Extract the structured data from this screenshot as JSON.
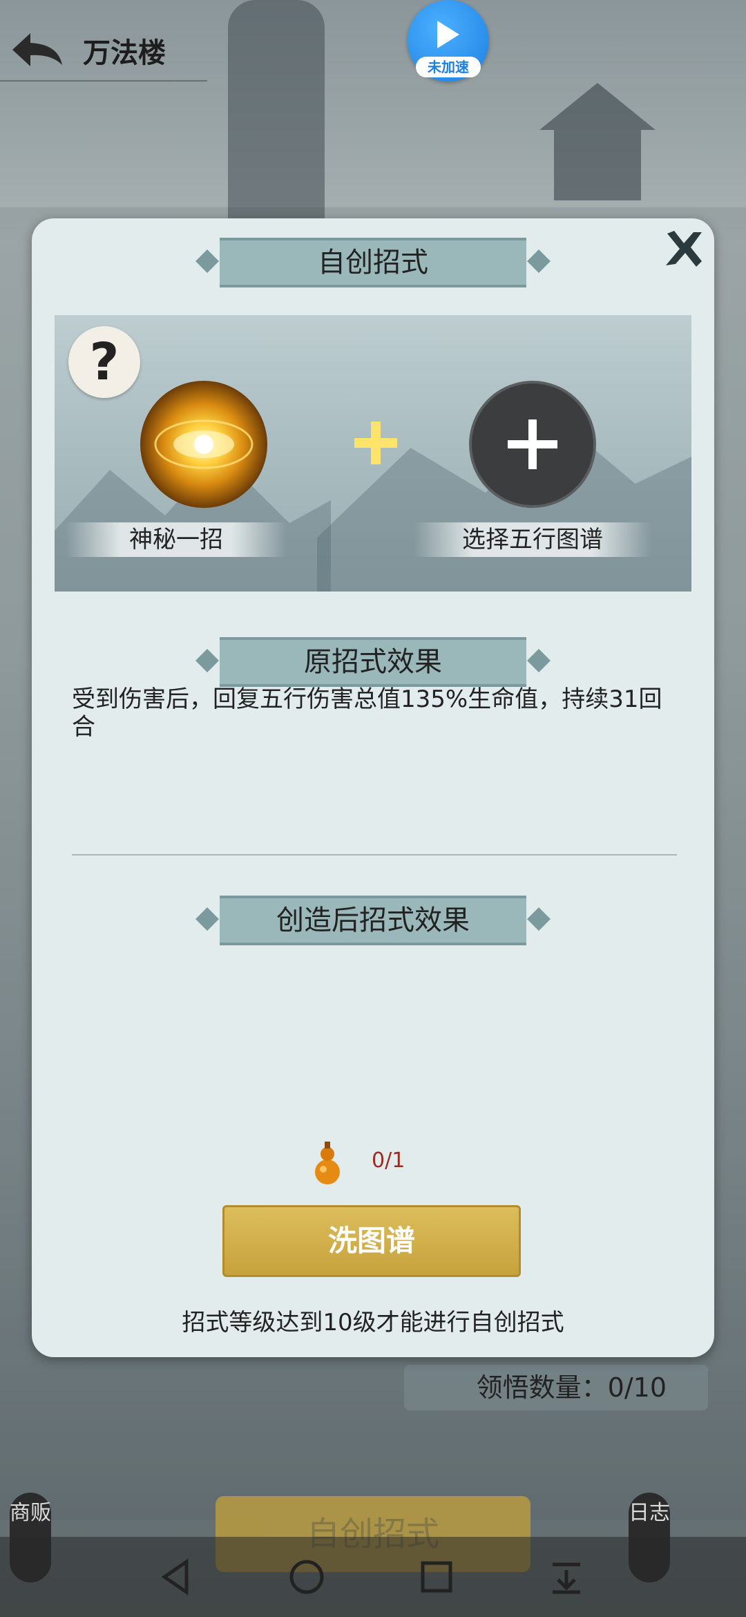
{
  "header": {
    "title": "万法楼",
    "speed_label": "未加速"
  },
  "modal": {
    "title": "自创招式",
    "help_symbol": "?",
    "left_slot_label": "神秘一招",
    "right_slot_label": "选择五行图谱",
    "original_effect_title": "原招式效果",
    "original_effect_text": "受到伤害后，回复五行伤害总值135%生命值，持续31回合",
    "created_effect_title": "创造后招式效果",
    "cost_count": "0/1",
    "wash_button": "洗图谱",
    "hint": "招式等级达到10级才能进行自创招式"
  },
  "background": {
    "understand_count": "领悟数量：0/10",
    "bottom_button": "自创招式",
    "left_side_label": "商贩",
    "right_side_label": "日志"
  },
  "colors": {
    "accent_gold": "#c7a23c",
    "ribbon": "#9ab7ba",
    "modal_bg": "#e3ecec",
    "speed_blue": "#1d7fe0",
    "cost_red": "#9a2c20"
  },
  "icons": [
    "back-arrow-icon",
    "play-icon",
    "close-icon",
    "question-icon",
    "skill-orb-icon",
    "plus-icon",
    "add-icon",
    "gourd-icon",
    "nav-back-icon",
    "nav-home-icon",
    "nav-recents-icon",
    "nav-menu-icon"
  ]
}
